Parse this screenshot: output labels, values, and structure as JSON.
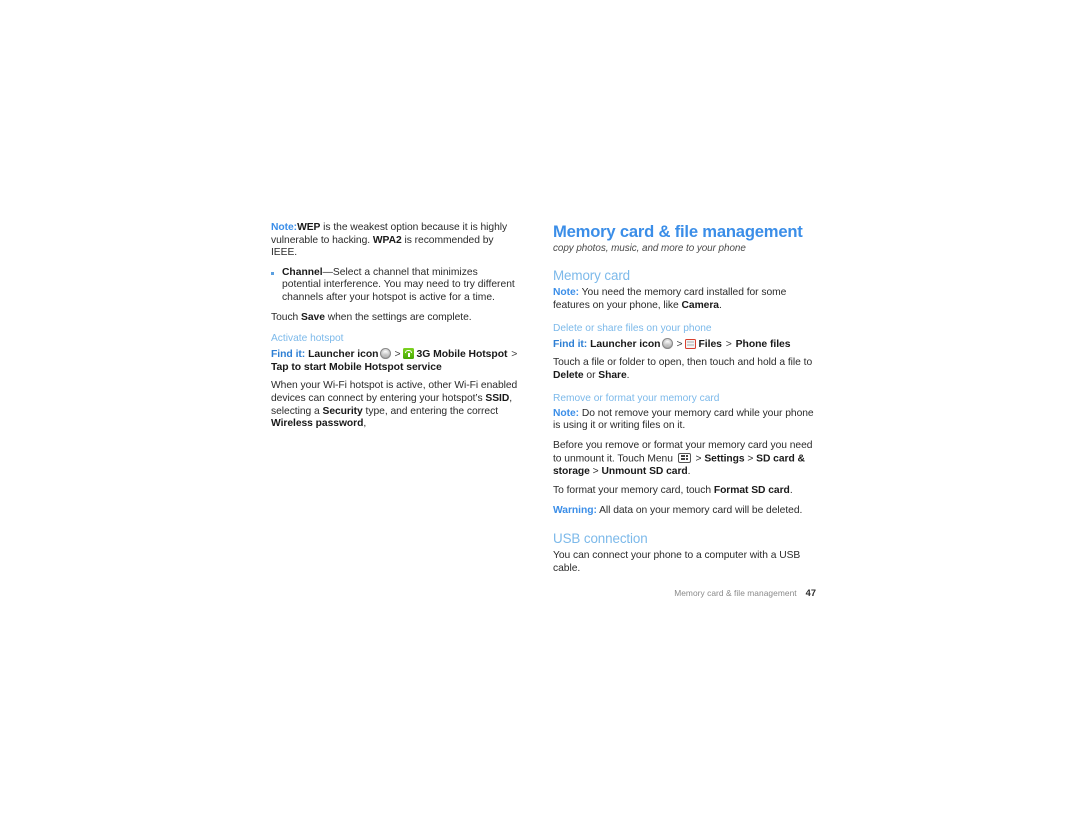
{
  "document": {
    "type": "user-guide-page",
    "page_number": "47",
    "background_color": "#ffffff",
    "accent_colors": {
      "heading_blue": "#3b8ee8",
      "subheading_blue": "#7cb9ea",
      "findit_blue": "#2d7fd4",
      "bullet_blue": "#5b9fe0",
      "body_text": "#2b2b2b",
      "footer_gray": "#8a8a8a"
    }
  },
  "left_column": {
    "note_paragraph": {
      "label": "Note:",
      "bold_1": "WEP",
      "text_1": " is the weakest option because it is highly vulnerable to hacking. ",
      "bold_2": "WPA2",
      "text_2": " is recommended by IEEE."
    },
    "bullets": [
      {
        "bold": "Channel",
        "text": "—Select a channel that minimizes potential interference. You may need to try different channels after your hotspot is active for a time."
      }
    ],
    "touch_save": {
      "text_1": "Touch ",
      "bold": "Save",
      "text_2": " when the settings are complete."
    },
    "subsection_title": "Activate hotspot",
    "find_it": {
      "label": "Find it:",
      "part_1": "Launcher icon",
      "icon_1": "launcher-icon",
      "sep_1": ">",
      "icon_2": "hotspot-icon",
      "part_2": "3G Mobile Hotspot",
      "sep_2": ">",
      "part_3": "Tap to start Mobile Hotspot service"
    },
    "body_paragraph": {
      "text_1": "When your Wi-Fi hotspot is active, other Wi-Fi enabled devices can connect by entering your hotspot’s ",
      "bold_1": "SSID",
      "text_2": ", selecting a ",
      "bold_2": "Security",
      "text_3": " type, and entering the correct ",
      "bold_3": "Wireless password",
      "text_4": ","
    }
  },
  "right_column": {
    "chapter_title": "Memory card & file management",
    "chapter_subtitle": "copy photos, music, and more to your phone",
    "memory_card": {
      "title": "Memory card",
      "note": {
        "label": "Note:",
        "text_1": " You need the memory card installed for some features on your phone, like ",
        "bold_1": "Camera",
        "text_2": "."
      }
    },
    "delete_share": {
      "title": "Delete or share files on your phone",
      "find_it": {
        "label": "Find it:",
        "part_1": "Launcher icon",
        "icon_1": "launcher-icon",
        "sep_1": ">",
        "icon_2": "files-icon",
        "part_2": "Files",
        "sep_2": ">",
        "part_3": "Phone files"
      },
      "body": {
        "text_1": "Touch a file or folder to open, then touch and hold a file to ",
        "bold_1": "Delete",
        "text_2": " or ",
        "bold_2": "Share",
        "text_3": "."
      }
    },
    "remove_format": {
      "title": "Remove or format your memory card",
      "note": {
        "label": "Note:",
        "text": " Do not remove your memory card while your phone is using it or writing files on it."
      },
      "unmount": {
        "text_1": "Before you remove or format your memory card you need to unmount it. Touch Menu ",
        "icon": "menu-icon",
        "sep_1": ">",
        "bold_1": "Settings",
        "sep_2": ">",
        "bold_2": "SD card & storage",
        "sep_3": ">",
        "bold_3": "Unmount SD card",
        "text_2": "."
      },
      "format": {
        "text_1": "To format your memory card, touch ",
        "bold_1": "Format SD card",
        "text_2": "."
      },
      "warning": {
        "label": "Warning:",
        "text": " All data on your memory card will be deleted."
      }
    },
    "usb_connection": {
      "title": "USB connection",
      "body": "You can connect your phone to a computer with a USB cable."
    }
  },
  "footer": {
    "running_head": "Memory card & file management",
    "page_number": "47"
  }
}
